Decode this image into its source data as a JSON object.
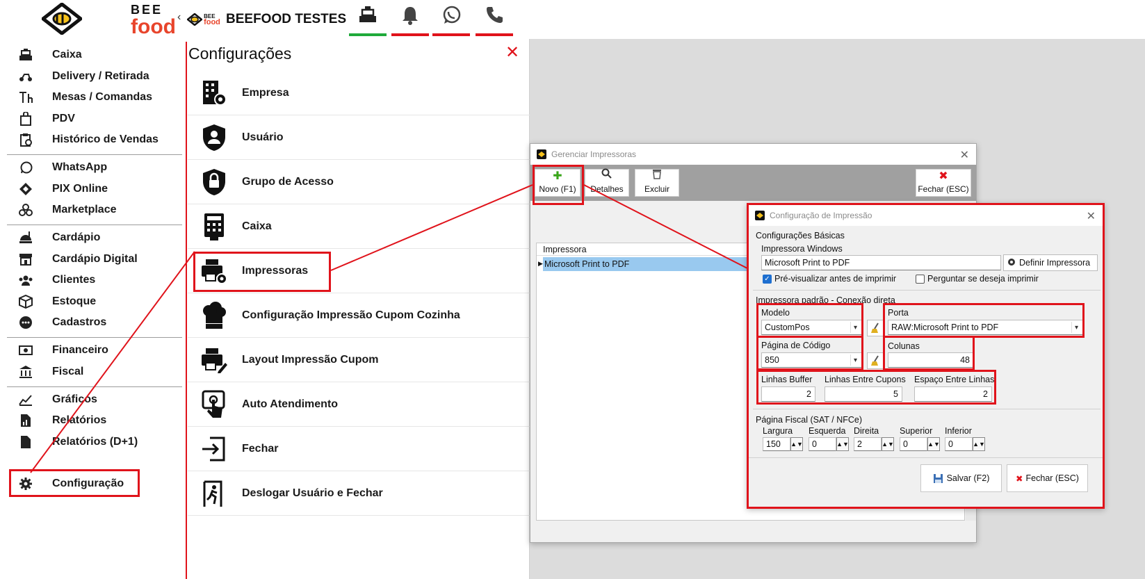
{
  "brand": {
    "bee": "BEE",
    "food": "food"
  },
  "sidebar": {
    "items": [
      {
        "label": "Caixa",
        "icon": "cash-register-icon"
      },
      {
        "label": "Delivery / Retirada",
        "icon": "scooter-icon"
      },
      {
        "label": "Mesas / Comandas",
        "icon": "table-icon"
      },
      {
        "label": "PDV",
        "icon": "shopping-bag-icon"
      },
      {
        "label": "Histórico de Vendas",
        "icon": "history-clipboard-icon"
      },
      {
        "label": "WhatsApp",
        "icon": "whatsapp-icon"
      },
      {
        "label": "PIX Online",
        "icon": "pix-icon"
      },
      {
        "label": "Marketplace",
        "icon": "marketplace-icon"
      },
      {
        "label": "Cardápio",
        "icon": "menu-food-icon"
      },
      {
        "label": "Cardápio Digital",
        "icon": "store-icon"
      },
      {
        "label": "Clientes",
        "icon": "users-icon"
      },
      {
        "label": "Estoque",
        "icon": "box-icon"
      },
      {
        "label": "Cadastros",
        "icon": "more-icon"
      },
      {
        "label": "Financeiro",
        "icon": "money-icon"
      },
      {
        "label": "Fiscal",
        "icon": "bank-icon"
      },
      {
        "label": "Gráficos",
        "icon": "chart-icon"
      },
      {
        "label": "Relatórios",
        "icon": "report-icon"
      },
      {
        "label": "Relatórios (D+1)",
        "icon": "report-d1-icon"
      },
      {
        "label": "Configuração",
        "icon": "gear-icon"
      }
    ]
  },
  "topbar": {
    "company": "BEEFOOD TESTES",
    "logo_small_top": "BEE",
    "logo_small_bottom": "food",
    "icons": [
      {
        "name": "cash-register-icon",
        "indicator": "#1faa3a"
      },
      {
        "name": "bell-icon",
        "indicator": "#e0131b"
      },
      {
        "name": "whatsapp-icon",
        "indicator": "#e0131b"
      },
      {
        "name": "phone-icon",
        "indicator": "#e0131b"
      }
    ]
  },
  "config": {
    "title": "Configurações",
    "close": "✕",
    "items": [
      {
        "label": "Empresa",
        "icon": "building-gear-icon"
      },
      {
        "label": "Usuário",
        "icon": "user-shield-icon"
      },
      {
        "label": "Grupo de Acesso",
        "icon": "lock-shield-icon"
      },
      {
        "label": "Caixa",
        "icon": "calculator-icon"
      },
      {
        "label": "Impressoras",
        "icon": "printer-gear-icon"
      },
      {
        "label": "Configuração Impressão Cupom Cozinha",
        "icon": "chef-hat-icon"
      },
      {
        "label": "Layout Impressão Cupom",
        "icon": "printer-edit-icon"
      },
      {
        "label": "Auto Atendimento",
        "icon": "touch-screen-icon"
      },
      {
        "label": "Fechar",
        "icon": "exit-icon"
      },
      {
        "label": "Deslogar Usuário e Fechar",
        "icon": "logout-run-icon"
      }
    ]
  },
  "printers_window": {
    "title": "Gerenciar Impressoras",
    "buttons": {
      "novo": "Novo (F1)",
      "detalhes": "Detalhes",
      "excluir": "Excluir",
      "fechar": "Fechar (ESC)"
    },
    "grid": {
      "header": "Impressora",
      "rows": [
        "Microsoft Print to PDF"
      ]
    }
  },
  "print_config": {
    "title": "Configuração de Impressão",
    "basic_group": "Configurações Básicas",
    "windows_printer_label": "Impressora Windows",
    "windows_printer_value": "Microsoft Print to PDF",
    "define_printer": "Definir Impressora",
    "preview_label": "Pré-visualizar antes de imprimir",
    "preview_checked": true,
    "ask_label": "Perguntar se deseja imprimir",
    "ask_checked": false,
    "direct_group": "Impressora padrão - Conexão direta",
    "modelo_label": "Modelo",
    "modelo_value": "CustomPos",
    "porta_label": "Porta",
    "porta_value": "RAW:Microsoft Print to PDF",
    "codepage_label": "Página de Código",
    "codepage_value": "850",
    "colunas_label": "Colunas",
    "colunas_value": "48",
    "buffer_label": "Linhas Buffer",
    "buffer_value": "2",
    "entre_cupons_label": "Linhas Entre Cupons",
    "entre_cupons_value": "5",
    "espaco_label": "Espaço Entre Linhas",
    "espaco_value": "2",
    "fiscal_group": "Página Fiscal (SAT / NFCe)",
    "largura_label": "Largura",
    "largura_value": "150",
    "esquerda_label": "Esquerda",
    "esquerda_value": "0",
    "direita_label": "Direita",
    "direita_value": "2",
    "superior_label": "Superior",
    "superior_value": "0",
    "inferior_label": "Inferior",
    "inferior_value": "0",
    "save": "Salvar (F2)",
    "close": "Fechar (ESC)"
  },
  "accent": {
    "red": "#e0131b",
    "green": "#1faa3a",
    "brand_orange": "#e8452c",
    "selection": "#99c9ef"
  }
}
